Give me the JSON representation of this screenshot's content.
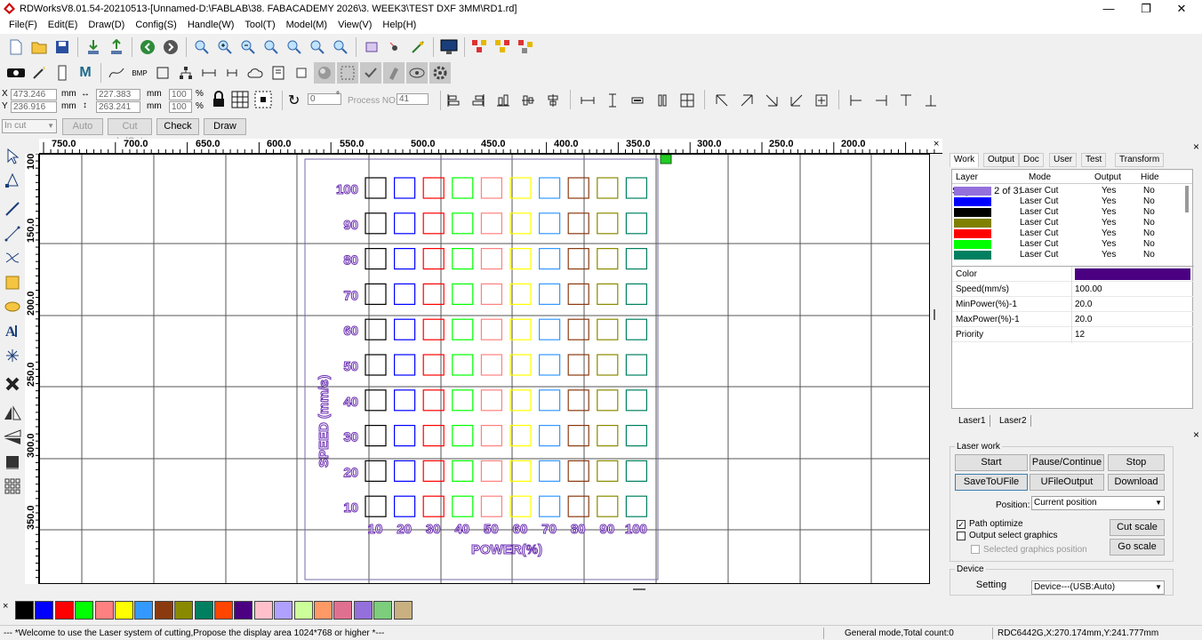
{
  "window": {
    "title": "RDWorksV8.01.54-20210513-[Unnamed-D:\\FABLAB\\38. FABACADEMY 2026\\3. WEEK3\\TEST DXF 3MM\\RD1.rd]",
    "minimize": "—",
    "maximize": "❐",
    "close": "✕"
  },
  "menu": [
    "File(F)",
    "Edit(E)",
    "Draw(D)",
    "Config(S)",
    "Handle(W)",
    "Tool(T)",
    "Model(M)",
    "View(V)",
    "Help(H)"
  ],
  "toolbar1": {
    "icons": [
      "new-file-icon",
      "open-folder-icon",
      "save-icon",
      "import-icon",
      "export-icon",
      "back-icon",
      "forward-icon",
      "zoom-icon",
      "zoom-in-icon",
      "zoom-out-icon",
      "zoom-fit-icon",
      "zoom-page-icon",
      "zoom-select-icon",
      "pan-icon",
      "frame-icon",
      "node-icon",
      "path-icon",
      "monitor-icon",
      "laser-cluster-1-icon",
      "laser-cluster-2-icon",
      "laser-cluster-3-icon"
    ]
  },
  "toolbar2": {
    "icons": [
      "camera-icon",
      "wand-icon",
      "ruler-icon",
      "m-text-icon",
      "curve-icon",
      "bmp-icon",
      "rect-icon",
      "tree-icon",
      "flip-h-icon",
      "flip-v-icon",
      "cloud-icon",
      "page-icon",
      "checkbox-icon",
      "sphere-icon",
      "select-box-icon",
      "check-icon",
      "eraser-icon",
      "eye-icon",
      "gear-icon"
    ],
    "m_label": "M",
    "bmp_label": "BMP"
  },
  "coords": {
    "x_label": "X",
    "y_label": "Y",
    "x": "473.246",
    "y": "236.916",
    "unit": "mm",
    "w": "227.383",
    "h": "263.241",
    "pw": "100",
    "ph": "100",
    "pct": "%",
    "rotate": "0",
    "deg": "°",
    "process_no_label": "Process NO:",
    "process_no": "41"
  },
  "toolbar4": {
    "in_cut": "In cut",
    "auto": "Auto",
    "cut_in_out": "Cut In/Out",
    "check": "Check",
    "draw": "Draw"
  },
  "ruler_top": [
    "750.0",
    "700.0",
    "650.0",
    "600.0",
    "550.0",
    "500.0",
    "450.0",
    "400.0",
    "350.0",
    "300.0",
    "250.0",
    "200.0"
  ],
  "ruler_left": [
    "100",
    "150.0",
    "200.0",
    "250.0",
    "300.0",
    "350.0"
  ],
  "canvas": {
    "speed_rows": [
      "100",
      "90",
      "80",
      "70",
      "60",
      "50",
      "40",
      "30",
      "20",
      "10"
    ],
    "power_cols": [
      "10",
      "20",
      "30",
      "40",
      "50",
      "60",
      "70",
      "80",
      "90",
      "100"
    ],
    "col_colors": [
      "#000000",
      "#0000ff",
      "#ff0000",
      "#00ff00",
      "#ff8080",
      "#ffff00",
      "#3399ff",
      "#8b3a0f",
      "#8a8a00",
      "#008060"
    ],
    "y_title": "SPEED (mm/s)",
    "x_title": "POWER(%)",
    "label_color": "#6a2db0"
  },
  "panel": {
    "close": "×",
    "tabs": [
      "Work",
      "Output",
      "Doc",
      "User",
      "Test",
      "Transform"
    ],
    "layer_headers": [
      "Layer",
      "Mode",
      "Output",
      "Hide"
    ],
    "layers": [
      {
        "color": "#9370db",
        "mode": "Laser Cut",
        "output": "Yes",
        "hide": "No"
      },
      {
        "color": "#0000ff",
        "mode": "Laser Cut",
        "output": "Yes",
        "hide": "No"
      },
      {
        "color": "#000000",
        "mode": "Laser Cut",
        "output": "Yes",
        "hide": "No"
      },
      {
        "color": "#808000",
        "mode": "Laser Cut",
        "output": "Yes",
        "hide": "No"
      },
      {
        "color": "#ff0000",
        "mode": "Laser Cut",
        "output": "Yes",
        "hide": "No"
      },
      {
        "color": "#00ff00",
        "mode": "Laser Cut",
        "output": "Yes",
        "hide": "No"
      },
      {
        "color": "#008060",
        "mode": "Laser Cut",
        "output": "Yes",
        "hide": "No"
      }
    ],
    "props": [
      {
        "label": "Color",
        "value": ""
      },
      {
        "label": "Speed(mm/s)",
        "value": "100.00"
      },
      {
        "label": "MinPower(%)-1",
        "value": "20.0"
      },
      {
        "label": "MaxPower(%)-1",
        "value": "20.0"
      },
      {
        "label": "Priority",
        "value": "12"
      }
    ],
    "color_value": "#4b0082",
    "subtabs": [
      "Laser1",
      "Laser2"
    ]
  },
  "laserwork": {
    "close": "×",
    "group": "Laser work",
    "start": "Start",
    "pause": "Pause/Continue",
    "stop": "Stop",
    "savetoufile": "SaveToUFile",
    "ufileoutput": "UFileOutput",
    "download": "Download",
    "position_label": "Position:",
    "position_value": "Current position",
    "path_optimize": "Path optimize",
    "output_select": "Output select graphics",
    "selected_pos": "Selected graphics position",
    "cut_scale": "Cut scale",
    "go_scale": "Go scale",
    "device_group": "Device",
    "setting": "Setting",
    "device_value": "Device---(USB:Auto)"
  },
  "palette": {
    "x_label": "×",
    "colors": [
      "#000000",
      "#0000ff",
      "#ff0000",
      "#00ff00",
      "#ff8080",
      "#ffff00",
      "#3399ff",
      "#8b3a0f",
      "#8a8a00",
      "#008060",
      "#ff4500",
      "#4b0082",
      "#ffc0cb",
      "#b0a0ff",
      "#ccff99",
      "#ff9966",
      "#e07090",
      "#9370db",
      "#7ccd7c",
      "#c8b080"
    ]
  },
  "status": {
    "left": "--- *Welcome to use the Laser system of cutting,Propose the display area 1024*768 or higher *---",
    "mode": "General mode,Total count:0",
    "coords": "RDC6442G,X:270.174mm,Y:241.777mm"
  }
}
